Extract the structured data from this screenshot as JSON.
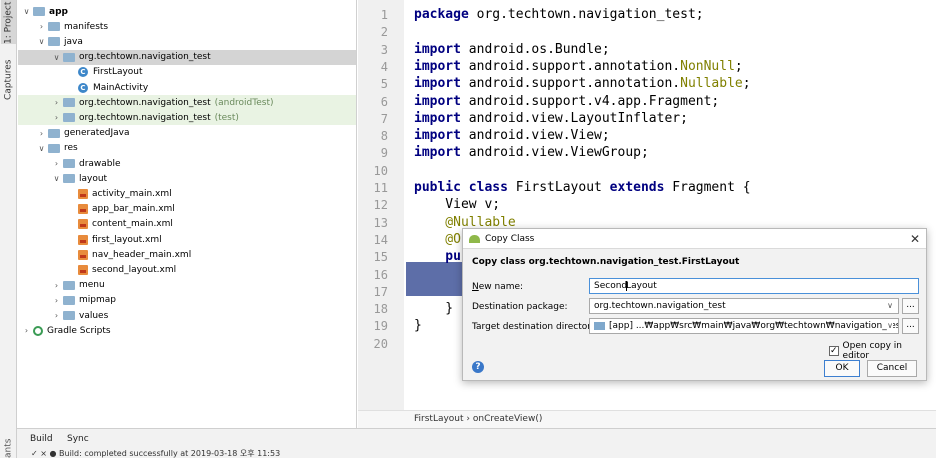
{
  "left_tabs": {
    "project": "1: Project",
    "captures": "Captures",
    "variants": "ants"
  },
  "tree": [
    {
      "label": "app",
      "bold": true,
      "arrow": "∨",
      "kind": "folder",
      "depth": 0
    },
    {
      "label": "manifests",
      "arrow": "›",
      "kind": "folder",
      "depth": 1
    },
    {
      "label": "java",
      "arrow": "∨",
      "kind": "folder",
      "depth": 1
    },
    {
      "label": "org.techtown.navigation_test",
      "arrow": "∨",
      "kind": "folder",
      "depth": 2
    },
    {
      "label": "FirstLayout",
      "kind": "class",
      "depth": 3
    },
    {
      "label": "MainActivity",
      "kind": "class",
      "depth": 3
    },
    {
      "label": "org.techtown.navigation_test",
      "suffix": "(androidTest)",
      "arrow": "›",
      "kind": "folder",
      "depth": 2
    },
    {
      "label": "org.techtown.navigation_test",
      "suffix": "(test)",
      "arrow": "›",
      "kind": "folder",
      "depth": 2
    },
    {
      "label": "generatedJava",
      "arrow": "›",
      "kind": "folder",
      "depth": 1
    },
    {
      "label": "res",
      "arrow": "∨",
      "kind": "folder",
      "depth": 1
    },
    {
      "label": "drawable",
      "arrow": "›",
      "kind": "folder",
      "depth": 2
    },
    {
      "label": "layout",
      "arrow": "∨",
      "kind": "folder",
      "depth": 2
    },
    {
      "label": "activity_main.xml",
      "kind": "xml",
      "depth": 3
    },
    {
      "label": "app_bar_main.xml",
      "kind": "xml",
      "depth": 3
    },
    {
      "label": "content_main.xml",
      "kind": "xml",
      "depth": 3
    },
    {
      "label": "first_layout.xml",
      "kind": "xml",
      "depth": 3
    },
    {
      "label": "nav_header_main.xml",
      "kind": "xml",
      "depth": 3
    },
    {
      "label": "second_layout.xml",
      "kind": "xml",
      "depth": 3
    },
    {
      "label": "menu",
      "arrow": "›",
      "kind": "folder",
      "depth": 2
    },
    {
      "label": "mipmap",
      "arrow": "›",
      "kind": "folder",
      "depth": 2
    },
    {
      "label": "values",
      "arrow": "›",
      "kind": "folder",
      "depth": 2
    },
    {
      "label": "Gradle Scripts",
      "arrow": "›",
      "kind": "gradle",
      "depth": 0
    }
  ],
  "editor": {
    "line_numbers": [
      "1",
      "2",
      "3",
      "4",
      "5",
      "6",
      "7",
      "8",
      "9",
      "10",
      "11",
      "12",
      "13",
      "14",
      "15",
      "16",
      "17",
      "18",
      "19",
      "20"
    ],
    "lines": [
      {
        "segments": [
          {
            "t": "package ",
            "c": "kw"
          },
          {
            "t": "org.techtown.navigation_test;",
            "c": "dim"
          }
        ]
      },
      {
        "segments": []
      },
      {
        "segments": [
          {
            "t": "import ",
            "c": "kw"
          },
          {
            "t": "android.os.Bundle;",
            "c": "dim"
          }
        ]
      },
      {
        "segments": [
          {
            "t": "import ",
            "c": "kw"
          },
          {
            "t": "android.support.annotation.",
            "c": "dim"
          },
          {
            "t": "NonNull",
            "c": "ann"
          },
          {
            "t": ";",
            "c": "dim"
          }
        ]
      },
      {
        "segments": [
          {
            "t": "import ",
            "c": "kw"
          },
          {
            "t": "android.support.annotation.",
            "c": "dim"
          },
          {
            "t": "Nullable",
            "c": "ann"
          },
          {
            "t": ";",
            "c": "dim"
          }
        ]
      },
      {
        "segments": [
          {
            "t": "import ",
            "c": "kw"
          },
          {
            "t": "android.support.v4.app.Fragment;",
            "c": "dim"
          }
        ]
      },
      {
        "segments": [
          {
            "t": "import ",
            "c": "kw"
          },
          {
            "t": "android.view.LayoutInflater;",
            "c": "dim"
          }
        ]
      },
      {
        "segments": [
          {
            "t": "import ",
            "c": "kw"
          },
          {
            "t": "android.view.View;",
            "c": "dim"
          }
        ]
      },
      {
        "segments": [
          {
            "t": "import ",
            "c": "kw"
          },
          {
            "t": "android.view.ViewGroup;",
            "c": "dim"
          }
        ]
      },
      {
        "segments": []
      },
      {
        "segments": [
          {
            "t": "public class ",
            "c": "kw"
          },
          {
            "t": "FirstLayout ",
            "c": "dim"
          },
          {
            "t": "extends ",
            "c": "kw"
          },
          {
            "t": "Fragment {",
            "c": "dim"
          }
        ]
      },
      {
        "segments": [
          {
            "t": "    View v;",
            "c": "dim"
          }
        ]
      },
      {
        "segments": [
          {
            "t": "    @Nullable",
            "c": "ann"
          }
        ]
      },
      {
        "segments": [
          {
            "t": "    @O",
            "c": "ann"
          }
        ]
      },
      {
        "segments": [
          {
            "t": "    pu",
            "c": "kw"
          }
        ]
      },
      {
        "segments": []
      },
      {
        "segments": []
      },
      {
        "segments": [
          {
            "t": "    }",
            "c": "dim"
          }
        ]
      },
      {
        "segments": [
          {
            "t": "}",
            "c": "dim"
          }
        ]
      },
      {
        "segments": []
      }
    ],
    "breadcrumb": "FirstLayout  ›  onCreateView()"
  },
  "bottom": {
    "build_tab": "Build",
    "sync_tab": "Sync",
    "status": "✓  ×   ● Build: completed successfully    at 2019-03-18 오후 11:53"
  },
  "dialog": {
    "title": "Copy Class",
    "heading": "Copy class org.techtown.navigation_test.FirstLayout",
    "new_name_label": "New name:",
    "new_name_value_before_caret": "Second",
    "new_name_value_after_caret": "Layout",
    "dest_package_label": "Destination package:",
    "dest_package_value": "org.techtown.navigation_test",
    "target_dir_label": "Target destination directory:",
    "target_dir_value": "[app] ...₩app₩src₩main₩java₩org₩techtown₩navigation_test",
    "open_copy_label": "Open copy in editor",
    "open_copy_checked": true,
    "ok_label": "OK",
    "cancel_label": "Cancel"
  }
}
